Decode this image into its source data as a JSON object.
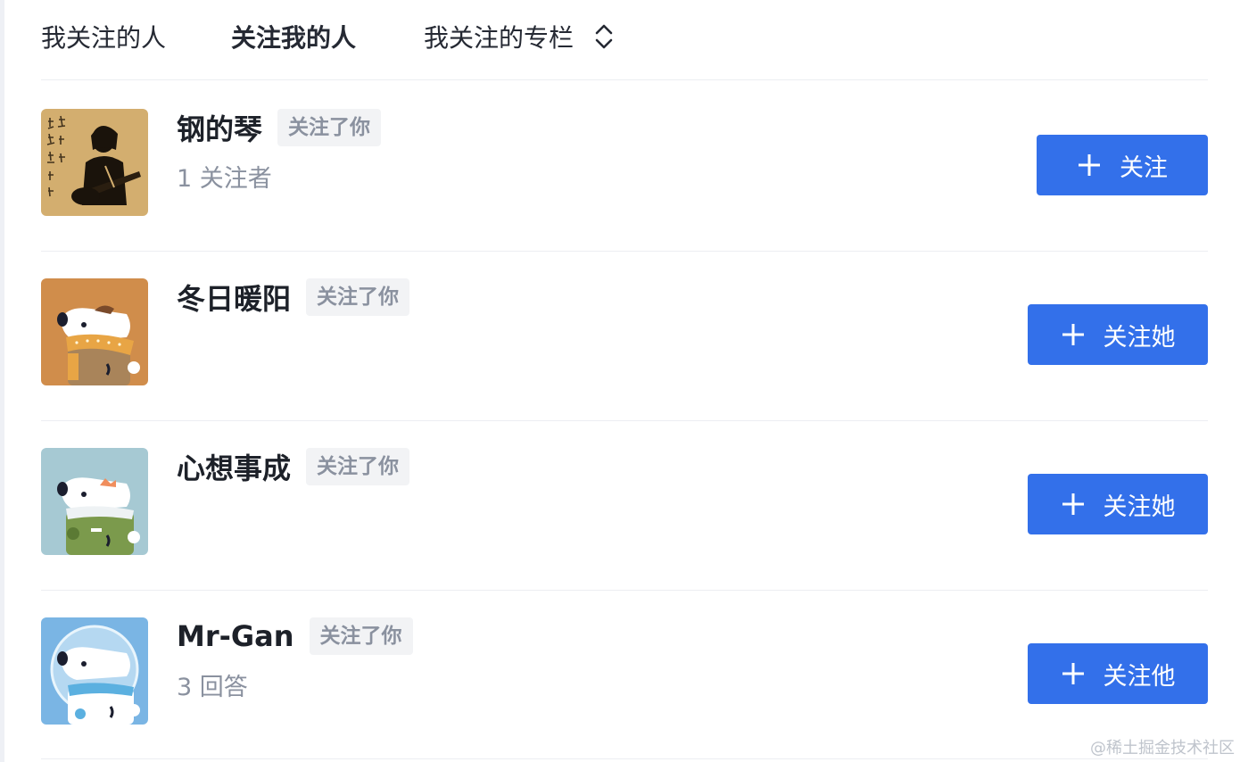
{
  "tabs": [
    {
      "label": "我关注的人",
      "active": false
    },
    {
      "label": "关注我的人",
      "active": true
    },
    {
      "label": "我关注的专栏",
      "active": false
    }
  ],
  "sort_icon": "chevron-up-down-icon",
  "users": [
    {
      "name": "钢的琴",
      "badge": "关注了你",
      "sub": "1 关注者",
      "button": "关注",
      "avatar": "guitarist-sketch"
    },
    {
      "name": "冬日暖阳",
      "badge": "关注了你",
      "sub": "",
      "button": "关注她",
      "avatar": "dog-orange-scarf"
    },
    {
      "name": "心想事成",
      "badge": "关注了你",
      "sub": "",
      "button": "关注她",
      "avatar": "dog-green-jacket"
    },
    {
      "name": "Mr-Gan",
      "badge": "关注了你",
      "sub": "3 回答",
      "button": "关注他",
      "avatar": "dog-astronaut"
    }
  ],
  "watermark": "@稀土掘金技术社区",
  "colors": {
    "accent": "#3370ea",
    "badge_bg": "#f2f3f5",
    "muted_text": "#8a919f"
  }
}
